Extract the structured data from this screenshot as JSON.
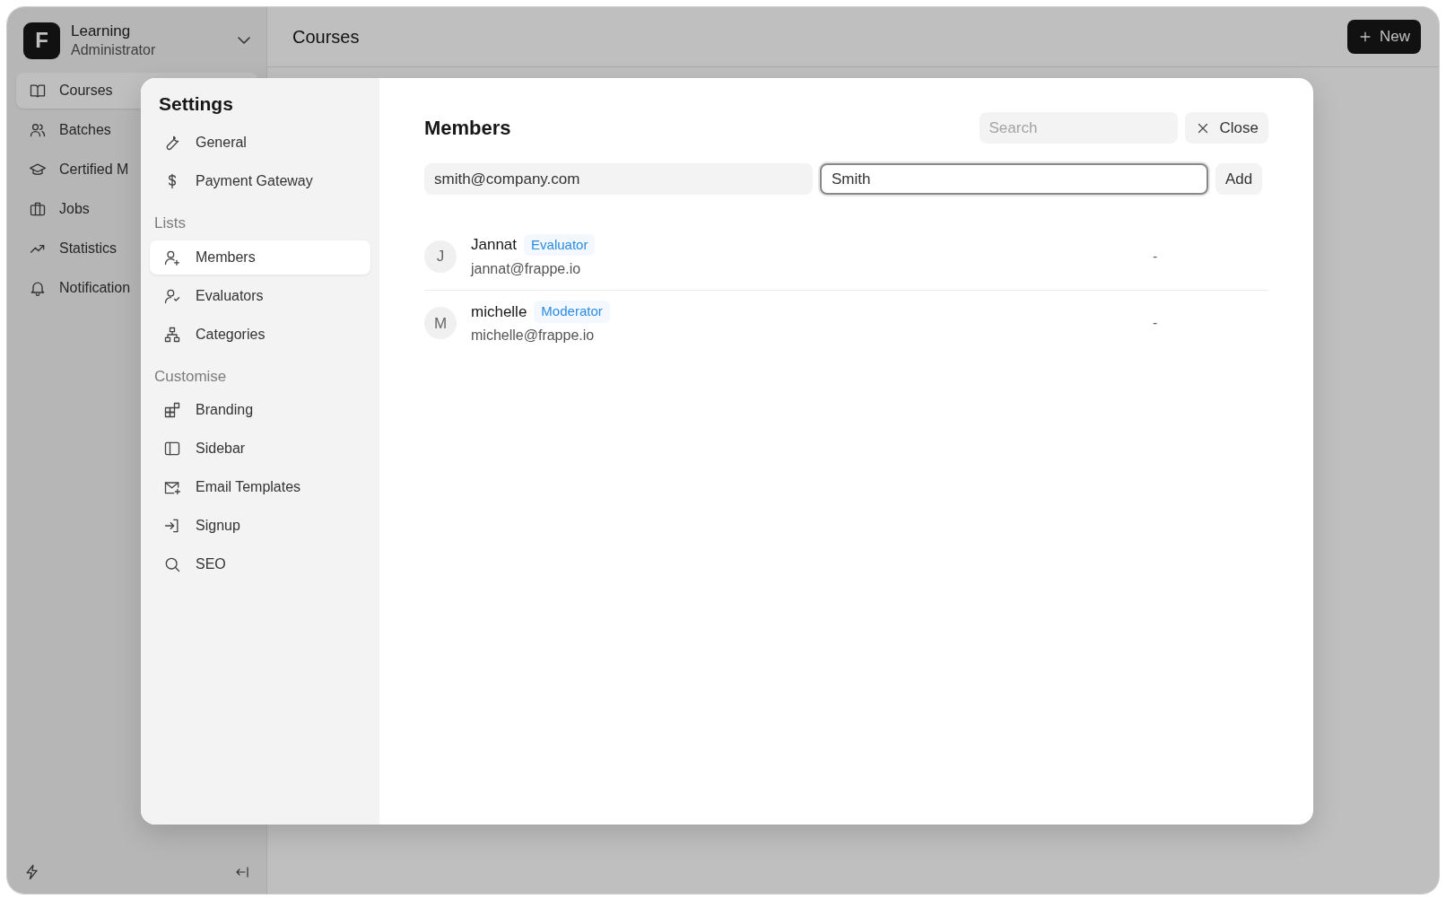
{
  "app": {
    "logo": "F",
    "title": "Learning",
    "subtitle": "Administrator"
  },
  "sidebar": {
    "items": [
      {
        "label": "Courses",
        "selected": true
      },
      {
        "label": "Batches",
        "selected": false
      },
      {
        "label": "Certified M",
        "selected": false
      },
      {
        "label": "Jobs",
        "selected": false
      },
      {
        "label": "Statistics",
        "selected": false
      },
      {
        "label": "Notification",
        "selected": false
      }
    ]
  },
  "header": {
    "title": "Courses",
    "new_button": "New"
  },
  "settings": {
    "title": "Settings",
    "sections": [
      {
        "items": [
          {
            "label": "General",
            "selected": false
          },
          {
            "label": "Payment Gateway",
            "selected": false
          }
        ]
      },
      {
        "heading": "Lists",
        "items": [
          {
            "label": "Members",
            "selected": true
          },
          {
            "label": "Evaluators",
            "selected": false
          },
          {
            "label": "Categories",
            "selected": false
          }
        ]
      },
      {
        "heading": "Customise",
        "items": [
          {
            "label": "Branding",
            "selected": false
          },
          {
            "label": "Sidebar",
            "selected": false
          },
          {
            "label": "Email Templates",
            "selected": false
          },
          {
            "label": "Signup",
            "selected": false
          },
          {
            "label": "SEO",
            "selected": false
          }
        ]
      }
    ]
  },
  "members": {
    "title": "Members",
    "search": {
      "placeholder": "Search"
    },
    "close_button": "Close",
    "email_field": {
      "value": "smith@company.com"
    },
    "name_field": {
      "value": "Smith"
    },
    "add_button": "Add",
    "rows": [
      {
        "initial": "J",
        "name": "Jannat",
        "role": "Evaluator",
        "email": "jannat@frappe.io",
        "column_3": "-"
      },
      {
        "initial": "M",
        "name": "michelle",
        "role": "Moderator",
        "email": "michelle@frappe.io",
        "column_3": "-"
      }
    ]
  }
}
